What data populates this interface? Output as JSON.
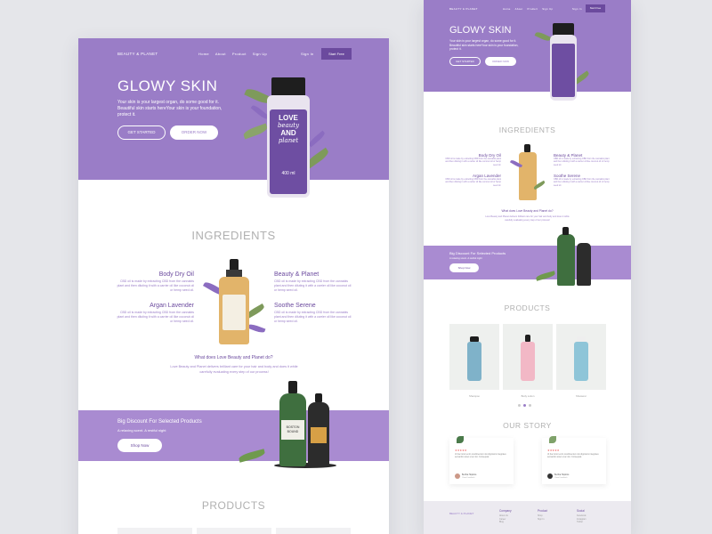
{
  "brand": "BEAUTY & PLANET",
  "nav": [
    "Home",
    "About",
    "Product",
    "Sign Up"
  ],
  "sign_in": "Sign In",
  "start_free": "Start Free",
  "hero": {
    "title": "GLOWY SKIN",
    "text": "Your skin is your largest organ, do some good for it. Beautiful skin starts hereYour skin is your foundation, protect it.",
    "get_started": "GET STARTED",
    "order_now": "ORDER NOW"
  },
  "bottle_label": {
    "line1": "LOVE",
    "line2": "beauty",
    "line3": "AND",
    "line4": "planet",
    "volume": "400 ml"
  },
  "ingredients": {
    "title": "INGREDIENTS",
    "desc": "CBD oil is made by extracting CBD from the cannabis plant and then diluting it with a carrier oil like coconut oil or hemp seed oil.",
    "items": [
      "Body Dry Oil",
      "Beauty & Planet",
      "Argan Lavender",
      "Soothe Serene"
    ],
    "question": "What does Love Beauty and Planet do?",
    "answer": "Love Beauty and Planet delivers brilliant care for your hair and body and does it while carefully evaluating every step of our process!"
  },
  "discount": {
    "title": "Big Discount For Selected Products",
    "subtitle": "A relaxing scent. A restful night",
    "button": "Shop Now",
    "bottle_brand1": "BOSTON",
    "bottle_brand2": "BOUND"
  },
  "products": {
    "title": "PRODUCTS",
    "names": [
      "Shampoo",
      "Body Lotion",
      "Showerer"
    ]
  },
  "story": {
    "title": "OUR STORY",
    "stars": "★★★★★",
    "review": "Ut hac tortor enim condimentum nisi dignissim integrates semantics amet ut ac nisi. Consequat.",
    "reviewer": "Bertha Hopkins",
    "role": "Client Feedback"
  },
  "footer": {
    "company": "Company",
    "product": "Product",
    "social": "Social",
    "links_company": [
      "About Us",
      "Career",
      "Blog"
    ],
    "links_product": [
      "Shop",
      "Sign In"
    ],
    "links_social": [
      "Facebook",
      "Instagram",
      "Twitter"
    ]
  },
  "colors": {
    "primary": "#9a7dc7",
    "dark_purple": "#6b4a9e",
    "background": "#e5e6ea"
  }
}
